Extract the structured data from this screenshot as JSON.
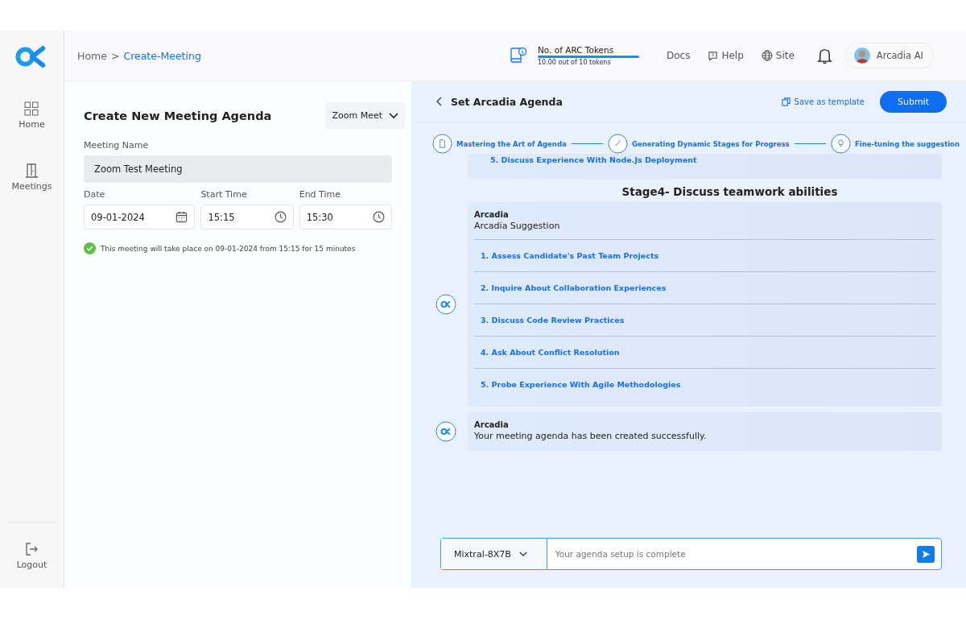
{
  "sidebar": {
    "items": [
      {
        "label": "Home",
        "selected": false
      },
      {
        "label": "Meetings",
        "selected": false
      }
    ],
    "logout": "Logout"
  },
  "breadcrumb": {
    "parent": "Home",
    "separator": ">",
    "current": "Create-Meeting"
  },
  "tokens": {
    "label": "No. of ARC Tokens",
    "level": 1.0,
    "reading": "10.00 out of 10 tokens"
  },
  "nav": [
    {
      "label": "Docs"
    },
    {
      "label": "Help"
    },
    {
      "label": "Site"
    }
  ],
  "user": {
    "name": "Arcadia AI"
  },
  "form": {
    "title": "Create New Meeting Agenda",
    "platform": "Zoom Meet",
    "name_label": "Meeting Name",
    "name_value": "Zoom Test Meeting",
    "fields": [
      {
        "label": "Date",
        "value": "09-01-2024"
      },
      {
        "label": "Start Time",
        "value": "15:15"
      },
      {
        "label": "End Time",
        "value": "15:30"
      }
    ],
    "notice": "This meeting will take place on 09-01-2024 from 15:15 for 15 minutes"
  },
  "agenda": {
    "title": "Set Arcadia Agenda",
    "save_template": "Save as template",
    "submit": "Submit",
    "steps": [
      {
        "label": "Mastering the Art of Agenda"
      },
      {
        "label": "Generating Dynamic Stages for Progress"
      },
      {
        "label": "Fine-tuning the suggestion"
      }
    ],
    "previous_item": "5. Discuss Experience With Node.Js Deployment",
    "stage_title": "Stage4- Discuss teamwork abilities",
    "messages": [
      {
        "sender": "Arcadia",
        "text": "Arcadia Suggestion",
        "items": [
          "1. Assess Candidate's Past Team Projects",
          "2. Inquire About Collaboration Experiences",
          "3. Discuss Code Review Practices",
          "4. Ask About Conflict Resolution",
          "5. Probe Experience With Agile Methodologies"
        ]
      },
      {
        "sender": "Arcadia",
        "text": "Your meeting agenda has been created successfully."
      }
    ],
    "model": "Mixtral-8X7B",
    "input_placeholder": "Your agenda setup is complete"
  }
}
